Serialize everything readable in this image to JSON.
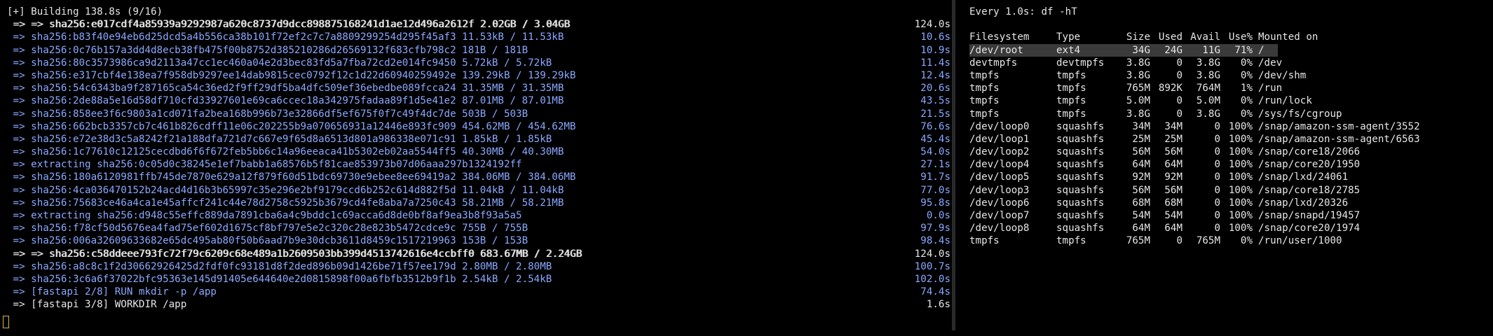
{
  "build": {
    "header": "[+] Building 138.8s (9/16)",
    "steps": [
      {
        "text": " => => sha256:e017cdf4a85939a9292987a620c8737d9dcc898875168241d1ae12d496a2612f 2.02GB / 3.04GB",
        "time": "124.0s",
        "white": true,
        "overlap_text": " => => sha256:e017cdf4a85939a9292987a620c8737d9dcc898875168241d1ae12d496a2612f 2.02GB / 3.04GB"
      },
      {
        "text": " => sha256:b83f40e94eb6d25dcd5a4b556ca38b101f72ef2c7c7a8809299254d295f45af3 11.53kB / 11.53kB",
        "time": "10.6s"
      },
      {
        "text": " => sha256:0c76b157a3dd4d8ecb38fb475f00b8752d385210286d26569132f683cfb798c2 181B / 181B",
        "time": "10.9s"
      },
      {
        "text": " => sha256:80c3573986ca9d2113a47cc1ec460a04e2d3bec83fd5a7fba72cd2e014fc9450 5.72kB / 5.72kB",
        "time": "11.4s"
      },
      {
        "text": " => sha256:e317cbf4e138ea7f958db9297ee14dab9815cec0792f12c1d22d60940259492e 139.29kB / 139.29kB",
        "time": "12.4s"
      },
      {
        "text": " => sha256:54c6343ba9f287165ca54c36ed2f9ff29df5ba4dfc509ef36ebedbe089fcca24 31.35MB / 31.35MB",
        "time": "20.6s"
      },
      {
        "text": " => sha256:2de88a5e16d58df710cfd33927601e69ca6ccec18a342975fadaa89f1d5e41e2 87.01MB / 87.01MB",
        "time": "43.5s"
      },
      {
        "text": " => sha256:858ee3f6c9803a1cd071fa2bea168b996b73e32866df5ef675f0f7c49f4dc7de 503B / 503B",
        "time": "21.5s"
      },
      {
        "text": " => sha256:662bcb3357cb7c461b826cdff11e06c202255b9a070656931a12446e893fc909 454.62MB / 454.62MB",
        "time": "76.6s"
      },
      {
        "text": " => sha256:e72e38d3c5a8242f21a188dfa721d7c667e9f65d8a6513d801a986338e071c91 1.85kB / 1.85kB",
        "time": "45.4s"
      },
      {
        "text": " => sha256:1c77610c12125cecdbd6f6f672feb5bb6c14a96eeaca41b5302eb02aa5544ff5 40.30MB / 40.30MB",
        "time": "54.0s"
      },
      {
        "text": " => extracting sha256:0c05d0c38245e1ef7babb1a68576b5f81cae853973b07d06aaa297b1324192ff",
        "time": "27.1s"
      },
      {
        "text": " => sha256:180a6120981ffb745de7870e629a12f879f60d51bdc69730e9ebee8ee69419a2 384.06MB / 384.06MB",
        "time": "91.7s"
      },
      {
        "text": " => sha256:4ca036470152b24acd4d16b3b65997c35e296e2bf9179ccd6b252c614d882f5d 11.04kB / 11.04kB",
        "time": "77.0s"
      },
      {
        "text": " => sha256:75683ce46a4ca1e45affcf241c44e78d2758c5925b3679cd4fe8aba7a7250c43 58.21MB / 58.21MB",
        "time": "95.8s"
      },
      {
        "text": " => extracting sha256:d948c55effc889da7891cba6a4c9bddc1c69acca6d8de0bf8af9ea3b8f93a5a5",
        "time": "0.0s"
      },
      {
        "text": " => sha256:f78cf50d5676ea4fad75ef602d1675cf8bf797e5e2c320c28e823b5472cdce9c 755B / 755B",
        "time": "97.9s"
      },
      {
        "text": " => sha256:006a32609633682e65dc495ab80f50b6aad7b9e30dcb3611d8459c1517219963 153B / 153B",
        "time": "98.4s"
      },
      {
        "text": " => => sha256:c58ddeee793fc72f79c6209c68e489a1b2609503bb399d4513742616e4ccbff0 683.67MB / 2.24GB",
        "time": "124.0s",
        "white": true,
        "overlap_text": " => => sha256:c58ddeee793fc72f79c6209c68e489a1b2609503bb399d4513742616e4ccbff0 683.67MB / 2.24GB"
      },
      {
        "text": " => sha256:a8c8c1f2d30662926425d2fdf0fc93181d8f2ded896b09d1426be71f57ee179d 2.80MB / 2.80MB",
        "time": "100.7s"
      },
      {
        "text": " => sha256:3c6a6f37022bfc95363e145d91405e644640e2d0815898f00a6fbfb3512b9f1b 2.54kB / 2.54kB",
        "time": "102.0s"
      },
      {
        "text": " => [fastapi 2/8] RUN mkdir -p /app",
        "time": "74.4s"
      },
      {
        "text": " => [fastapi 3/8] WORKDIR /app",
        "time": "1.6s",
        "white": true
      }
    ]
  },
  "watch": {
    "header": "Every 1.0s: df -hT",
    "columns": [
      "Filesystem",
      "Type",
      "Size",
      "Used",
      "Avail",
      "Use%",
      "Mounted on"
    ],
    "rows": [
      {
        "fs": "/dev/root",
        "type": "ext4",
        "size": "34G",
        "used": "24G",
        "avail": "11G",
        "use": "71%",
        "mount": "/",
        "highlight": true
      },
      {
        "fs": "devtmpfs",
        "type": "devtmpfs",
        "size": "3.8G",
        "used": "0",
        "avail": "3.8G",
        "use": "0%",
        "mount": "/dev"
      },
      {
        "fs": "tmpfs",
        "type": "tmpfs",
        "size": "3.8G",
        "used": "0",
        "avail": "3.8G",
        "use": "0%",
        "mount": "/dev/shm"
      },
      {
        "fs": "tmpfs",
        "type": "tmpfs",
        "size": "765M",
        "used": "892K",
        "avail": "764M",
        "use": "1%",
        "mount": "/run"
      },
      {
        "fs": "tmpfs",
        "type": "tmpfs",
        "size": "5.0M",
        "used": "0",
        "avail": "5.0M",
        "use": "0%",
        "mount": "/run/lock"
      },
      {
        "fs": "tmpfs",
        "type": "tmpfs",
        "size": "3.8G",
        "used": "0",
        "avail": "3.8G",
        "use": "0%",
        "mount": "/sys/fs/cgroup"
      },
      {
        "fs": "/dev/loop0",
        "type": "squashfs",
        "size": "34M",
        "used": "34M",
        "avail": "0",
        "use": "100%",
        "mount": "/snap/amazon-ssm-agent/3552"
      },
      {
        "fs": "/dev/loop1",
        "type": "squashfs",
        "size": "25M",
        "used": "25M",
        "avail": "0",
        "use": "100%",
        "mount": "/snap/amazon-ssm-agent/6563"
      },
      {
        "fs": "/dev/loop2",
        "type": "squashfs",
        "size": "56M",
        "used": "56M",
        "avail": "0",
        "use": "100%",
        "mount": "/snap/core18/2066"
      },
      {
        "fs": "/dev/loop4",
        "type": "squashfs",
        "size": "64M",
        "used": "64M",
        "avail": "0",
        "use": "100%",
        "mount": "/snap/core20/1950"
      },
      {
        "fs": "/dev/loop5",
        "type": "squashfs",
        "size": "92M",
        "used": "92M",
        "avail": "0",
        "use": "100%",
        "mount": "/snap/lxd/24061"
      },
      {
        "fs": "/dev/loop3",
        "type": "squashfs",
        "size": "56M",
        "used": "56M",
        "avail": "0",
        "use": "100%",
        "mount": "/snap/core18/2785"
      },
      {
        "fs": "/dev/loop6",
        "type": "squashfs",
        "size": "68M",
        "used": "68M",
        "avail": "0",
        "use": "100%",
        "mount": "/snap/lxd/20326"
      },
      {
        "fs": "/dev/loop7",
        "type": "squashfs",
        "size": "54M",
        "used": "54M",
        "avail": "0",
        "use": "100%",
        "mount": "/snap/snapd/19457"
      },
      {
        "fs": "/dev/loop8",
        "type": "squashfs",
        "size": "64M",
        "used": "64M",
        "avail": "0",
        "use": "100%",
        "mount": "/snap/core20/1974"
      },
      {
        "fs": "tmpfs",
        "type": "tmpfs",
        "size": "765M",
        "used": "0",
        "avail": "765M",
        "use": "0%",
        "mount": "/run/user/1000"
      }
    ]
  }
}
